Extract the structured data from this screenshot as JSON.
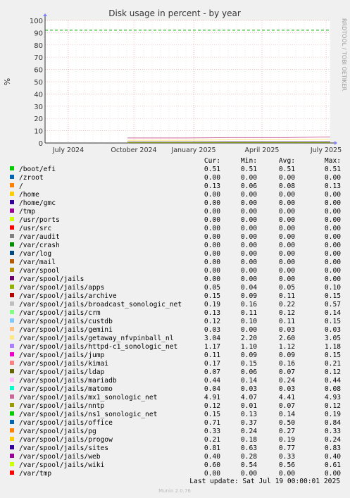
{
  "chart_data": {
    "type": "line",
    "title": "Disk usage in percent - by year",
    "ylabel": "%",
    "side_label": "RRDTOOL / TOBI OETIKER",
    "ylim": [
      0,
      100
    ],
    "y_ticks": [
      0,
      10,
      20,
      30,
      40,
      50,
      60,
      70,
      80,
      90,
      100
    ],
    "x_ticks": [
      "July 2024",
      "October 2024",
      "January 2025",
      "April 2025",
      "July 2025"
    ],
    "warning_line": 92,
    "grid": true,
    "columns": [
      "Cur:",
      "Min:",
      "Avg:",
      "Max:"
    ],
    "series": [
      {
        "name": "/boot/efi",
        "color": "#00cc00",
        "cur": "0.51",
        "min": "0.51",
        "avg": "0.51",
        "max": "0.51"
      },
      {
        "name": "/zroot",
        "color": "#0066b3",
        "cur": "0.00",
        "min": "0.00",
        "avg": "0.00",
        "max": "0.00"
      },
      {
        "name": "/",
        "color": "#ff8000",
        "cur": "0.13",
        "min": "0.06",
        "avg": "0.08",
        "max": "0.13"
      },
      {
        "name": "/home",
        "color": "#ffcc00",
        "cur": "0.00",
        "min": "0.00",
        "avg": "0.00",
        "max": "0.00"
      },
      {
        "name": "/home/gmc",
        "color": "#330099",
        "cur": "0.00",
        "min": "0.00",
        "avg": "0.00",
        "max": "0.00"
      },
      {
        "name": "/tmp",
        "color": "#990099",
        "cur": "0.00",
        "min": "0.00",
        "avg": "0.00",
        "max": "0.00"
      },
      {
        "name": "/usr/ports",
        "color": "#ccff00",
        "cur": "0.00",
        "min": "0.00",
        "avg": "0.00",
        "max": "0.00"
      },
      {
        "name": "/usr/src",
        "color": "#ff0000",
        "cur": "0.00",
        "min": "0.00",
        "avg": "0.00",
        "max": "0.00"
      },
      {
        "name": "/var/audit",
        "color": "#808080",
        "cur": "0.00",
        "min": "0.00",
        "avg": "0.00",
        "max": "0.00"
      },
      {
        "name": "/var/crash",
        "color": "#008f00",
        "cur": "0.00",
        "min": "0.00",
        "avg": "0.00",
        "max": "0.00"
      },
      {
        "name": "/var/log",
        "color": "#00487d",
        "cur": "0.00",
        "min": "0.00",
        "avg": "0.00",
        "max": "0.00"
      },
      {
        "name": "/var/mail",
        "color": "#b35a00",
        "cur": "0.00",
        "min": "0.00",
        "avg": "0.00",
        "max": "0.00"
      },
      {
        "name": "/var/spool",
        "color": "#b38f00",
        "cur": "0.00",
        "min": "0.00",
        "avg": "0.00",
        "max": "0.00"
      },
      {
        "name": "/var/spool/jails",
        "color": "#6b006b",
        "cur": "0.00",
        "min": "0.00",
        "avg": "0.00",
        "max": "0.00"
      },
      {
        "name": "/var/spool/jails/apps",
        "color": "#8fb300",
        "cur": "0.05",
        "min": "0.04",
        "avg": "0.05",
        "max": "0.10"
      },
      {
        "name": "/var/spool/jails/archive",
        "color": "#b30000",
        "cur": "0.15",
        "min": "0.09",
        "avg": "0.11",
        "max": "0.15"
      },
      {
        "name": "/var/spool/jails/broadcast_sonologic_net",
        "color": "#bebebe",
        "cur": "0.19",
        "min": "0.16",
        "avg": "0.22",
        "max": "0.57"
      },
      {
        "name": "/var/spool/jails/crm",
        "color": "#80ff80",
        "cur": "0.13",
        "min": "0.11",
        "avg": "0.12",
        "max": "0.14"
      },
      {
        "name": "/var/spool/jails/custdb",
        "color": "#80c9ff",
        "cur": "0.12",
        "min": "0.10",
        "avg": "0.11",
        "max": "0.15"
      },
      {
        "name": "/var/spool/jails/gemini",
        "color": "#ffc080",
        "cur": "0.03",
        "min": "0.00",
        "avg": "0.03",
        "max": "0.03"
      },
      {
        "name": "/var/spool/jails/getaway_nfvpinball_nl",
        "color": "#ffe680",
        "cur": "3.04",
        "min": "2.20",
        "avg": "2.60",
        "max": "3.05"
      },
      {
        "name": "/var/spool/jails/httpd-c1_sonologic_net",
        "color": "#aa80ff",
        "cur": "1.17",
        "min": "1.10",
        "avg": "1.12",
        "max": "1.18"
      },
      {
        "name": "/var/spool/jails/jump",
        "color": "#ee00cc",
        "cur": "0.11",
        "min": "0.09",
        "avg": "0.09",
        "max": "0.15"
      },
      {
        "name": "/var/spool/jails/kimai",
        "color": "#ff8080",
        "cur": "0.17",
        "min": "0.15",
        "avg": "0.16",
        "max": "0.21"
      },
      {
        "name": "/var/spool/jails/ldap",
        "color": "#666600",
        "cur": "0.07",
        "min": "0.06",
        "avg": "0.07",
        "max": "0.12"
      },
      {
        "name": "/var/spool/jails/mariadb",
        "color": "#ffbfff",
        "cur": "0.44",
        "min": "0.14",
        "avg": "0.24",
        "max": "0.44"
      },
      {
        "name": "/var/spool/jails/matomo",
        "color": "#00ffcc",
        "cur": "0.04",
        "min": "0.03",
        "avg": "0.03",
        "max": "0.08"
      },
      {
        "name": "/var/spool/jails/mx1_sonologic_net",
        "color": "#cc6699",
        "cur": "4.91",
        "min": "4.07",
        "avg": "4.41",
        "max": "4.93"
      },
      {
        "name": "/var/spool/jails/nntp",
        "color": "#999900",
        "cur": "0.12",
        "min": "0.01",
        "avg": "0.07",
        "max": "0.12"
      },
      {
        "name": "/var/spool/jails/ns1_sonologic_net",
        "color": "#00cc00",
        "cur": "0.15",
        "min": "0.13",
        "avg": "0.14",
        "max": "0.19"
      },
      {
        "name": "/var/spool/jails/office",
        "color": "#0066b3",
        "cur": "0.71",
        "min": "0.37",
        "avg": "0.50",
        "max": "0.84"
      },
      {
        "name": "/var/spool/jails/pg",
        "color": "#ff8000",
        "cur": "0.33",
        "min": "0.24",
        "avg": "0.27",
        "max": "0.33"
      },
      {
        "name": "/var/spool/jails/progow",
        "color": "#ffcc00",
        "cur": "0.21",
        "min": "0.18",
        "avg": "0.19",
        "max": "0.24"
      },
      {
        "name": "/var/spool/jails/sites",
        "color": "#330099",
        "cur": "0.81",
        "min": "0.63",
        "avg": "0.77",
        "max": "0.83"
      },
      {
        "name": "/var/spool/jails/web",
        "color": "#990099",
        "cur": "0.40",
        "min": "0.28",
        "avg": "0.33",
        "max": "0.40"
      },
      {
        "name": "/var/spool/jails/wiki",
        "color": "#ccff00",
        "cur": "0.60",
        "min": "0.54",
        "avg": "0.56",
        "max": "0.61"
      },
      {
        "name": "/var/tmp",
        "color": "#ff0000",
        "cur": "0.00",
        "min": "0.00",
        "avg": "0.00",
        "max": "0.00"
      }
    ],
    "last_update": "Last update:  Sat Jul 19 00:00:01 2025",
    "footer": "Munin 2.0.76"
  }
}
